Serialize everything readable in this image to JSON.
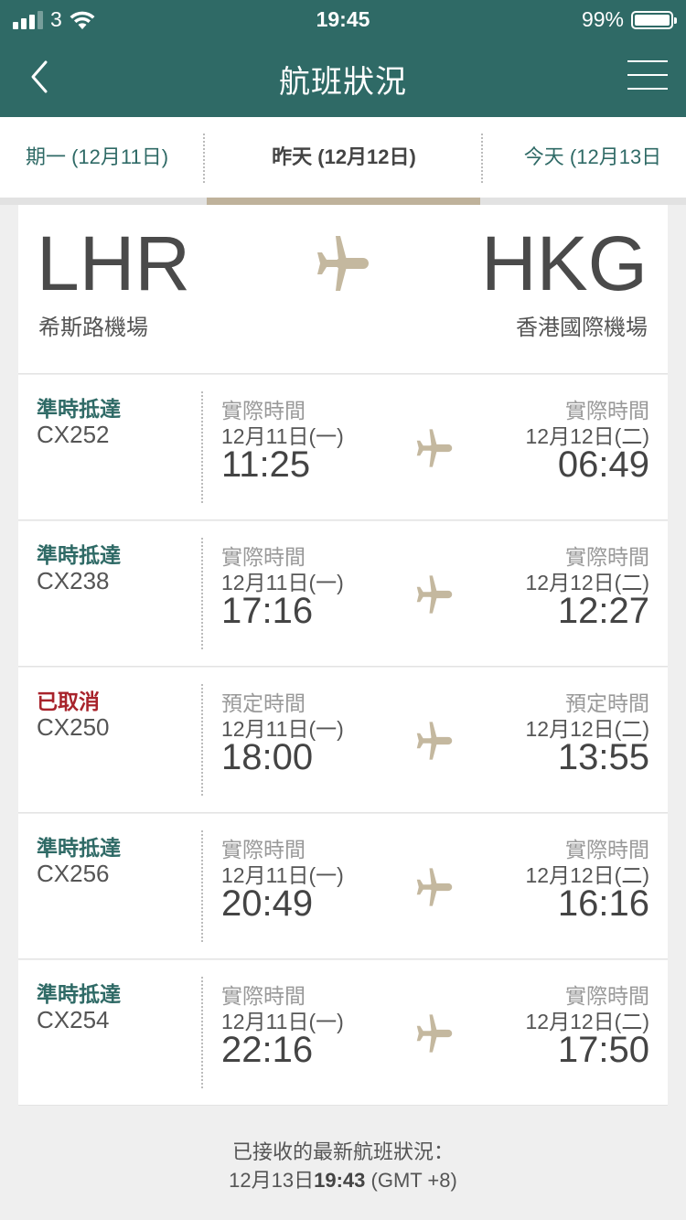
{
  "status_bar": {
    "carrier": "3",
    "time": "19:45",
    "battery": "99%"
  },
  "header": {
    "title": "航班狀況"
  },
  "date_tabs": [
    {
      "label": "期一 (12月11日)"
    },
    {
      "label": "昨天 (12月12日)"
    },
    {
      "label": "今天 (12月13日"
    }
  ],
  "route": {
    "from_code": "LHR",
    "from_name": "希斯路機場",
    "to_code": "HKG",
    "to_name": "香港國際機場"
  },
  "flights": [
    {
      "status": "準時抵達",
      "flight_no": "CX252",
      "dep_label": "實際時間",
      "dep_date": "12月11日(一)",
      "dep_time": "11:25",
      "arr_label": "實際時間",
      "arr_date": "12月12日(二)",
      "arr_time": "06:49"
    },
    {
      "status": "準時抵達",
      "flight_no": "CX238",
      "dep_label": "實際時間",
      "dep_date": "12月11日(一)",
      "dep_time": "17:16",
      "arr_label": "實際時間",
      "arr_date": "12月12日(二)",
      "arr_time": "12:27"
    },
    {
      "status": "已取消",
      "flight_no": "CX250",
      "dep_label": "預定時間",
      "dep_date": "12月11日(一)",
      "dep_time": "18:00",
      "arr_label": "預定時間",
      "arr_date": "12月12日(二)",
      "arr_time": "13:55"
    },
    {
      "status": "準時抵達",
      "flight_no": "CX256",
      "dep_label": "實際時間",
      "dep_date": "12月11日(一)",
      "dep_time": "20:49",
      "arr_label": "實際時間",
      "arr_date": "12月12日(二)",
      "arr_time": "16:16"
    },
    {
      "status": "準時抵達",
      "flight_no": "CX254",
      "dep_label": "實際時間",
      "dep_date": "12月11日(一)",
      "dep_time": "22:16",
      "arr_label": "實際時間",
      "arr_date": "12月12日(二)",
      "arr_time": "17:50"
    }
  ],
  "footer": {
    "label": "已接收的最新航班狀況：",
    "date": "12月13日",
    "time": "19:43",
    "timezone": " (GMT +8)"
  },
  "colors": {
    "header": "#2f6a66",
    "accent": "#bfb29b",
    "cancelled": "#a8232b"
  }
}
